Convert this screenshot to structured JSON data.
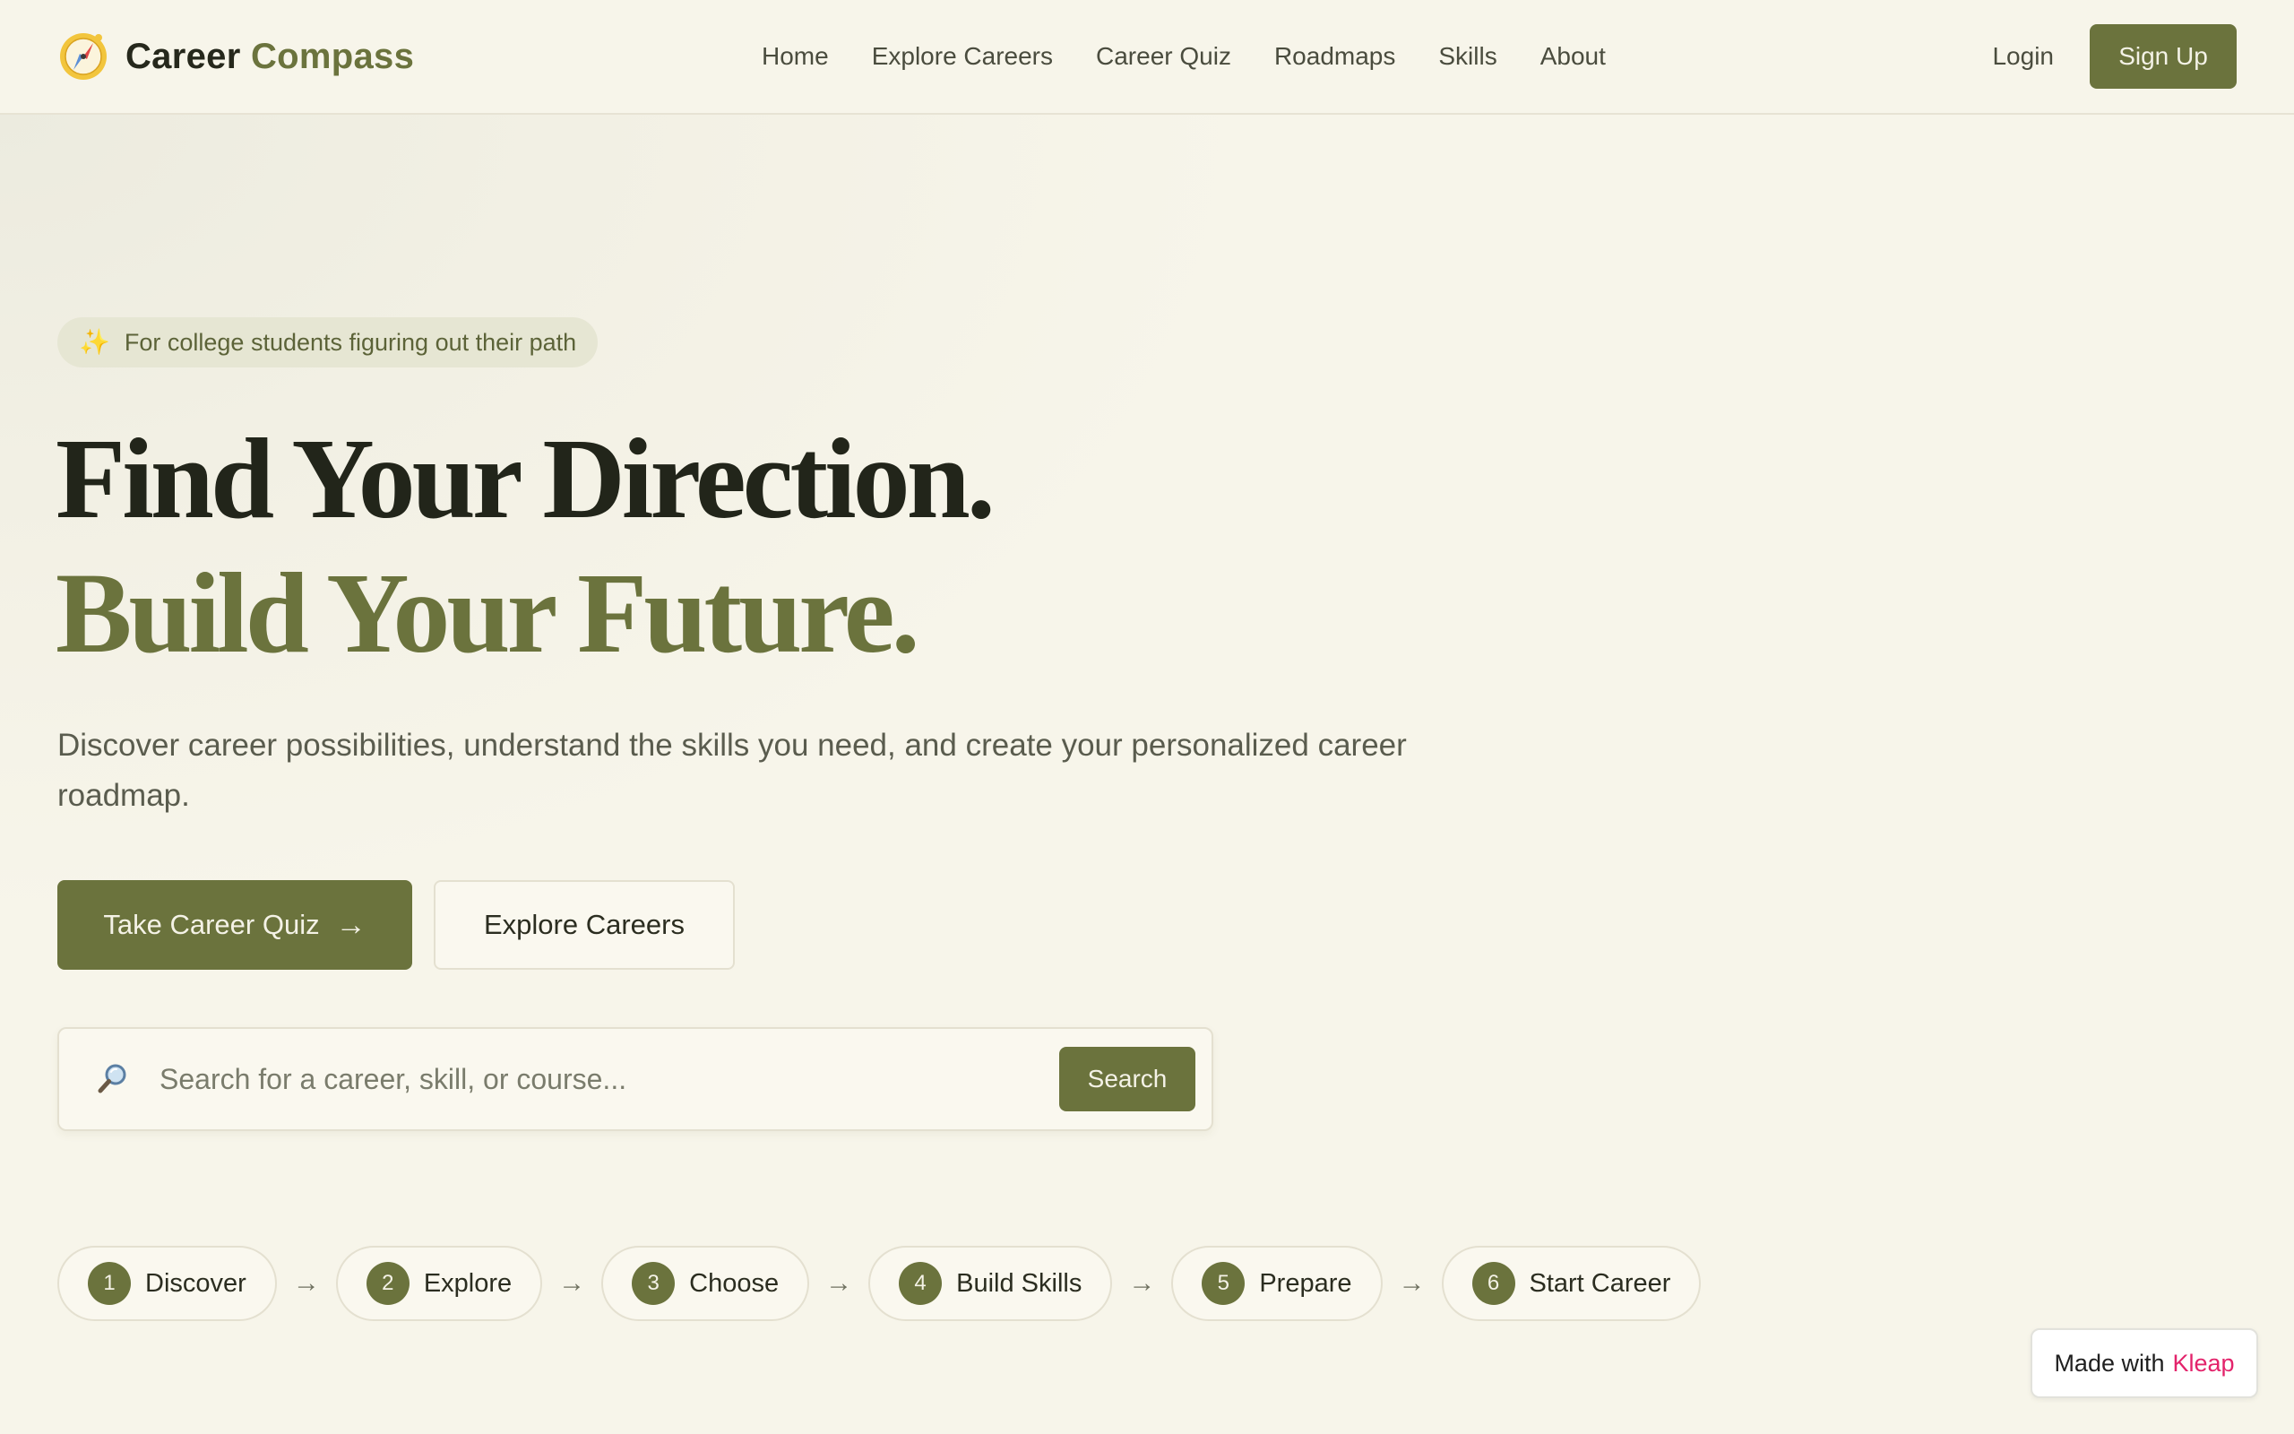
{
  "navbar": {
    "brand": {
      "icon": "compass-icon",
      "name_part1": "Career",
      "name_part2": "Compass"
    },
    "links": [
      {
        "label": "Home"
      },
      {
        "label": "Explore Careers"
      },
      {
        "label": "Career Quiz"
      },
      {
        "label": "Roadmaps"
      },
      {
        "label": "Skills"
      },
      {
        "label": "About"
      }
    ],
    "login_label": "Login",
    "signup_label": "Sign Up"
  },
  "hero": {
    "badge": {
      "icon": "sparkles-icon",
      "icon_glyph": "✨",
      "text": "For college students figuring out their path"
    },
    "headline_line1": "Find Your Direction.",
    "headline_line2": "Build Your Future.",
    "subtext": "Discover career possibilities, understand the skills you need, and create your personalized career roadmap.",
    "primary_cta": {
      "label": "Take Career Quiz",
      "arrow": "→"
    },
    "secondary_cta": {
      "label": "Explore Careers"
    },
    "search": {
      "icon": "search-icon",
      "value": "",
      "placeholder": "Search for a career, skill, or course...",
      "button_label": "Search"
    }
  },
  "steps": {
    "arrow": "→",
    "items": [
      {
        "number": "1",
        "label": "Discover"
      },
      {
        "number": "2",
        "label": "Explore"
      },
      {
        "number": "3",
        "label": "Choose"
      },
      {
        "number": "4",
        "label": "Build Skills"
      },
      {
        "number": "5",
        "label": "Prepare"
      },
      {
        "number": "6",
        "label": "Start Career"
      }
    ]
  },
  "made_with": {
    "prefix": "Made with",
    "brand": "Kleap"
  },
  "colors": {
    "accent": "#6b733d",
    "background": "#f7f5ea",
    "heading_dark": "#22251a",
    "kleap_pink": "#e3236b"
  }
}
